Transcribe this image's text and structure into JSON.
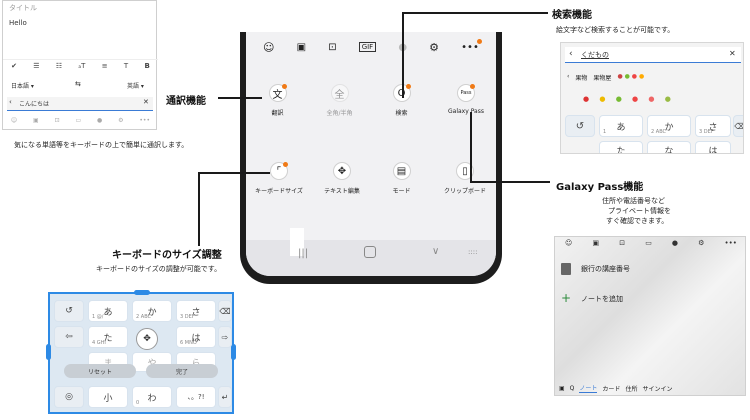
{
  "phone": {
    "toolbar_icons": [
      "smiley-icon",
      "sticker-icon",
      "emoji-icon",
      "gif-icon",
      "mic-icon",
      "gear-icon",
      "more-icon"
    ],
    "tools_row1": [
      {
        "label": "翻訳",
        "icon": "translate-icon",
        "dot": true
      },
      {
        "label": "全角/半角",
        "icon": "width-icon",
        "dot": false,
        "disabled": true
      },
      {
        "label": "検索",
        "icon": "search-icon",
        "dot": true
      },
      {
        "label": "Galaxy Pass",
        "icon": "pass-icon",
        "dot": true
      }
    ],
    "tools_row2": [
      {
        "label": "キーボードサイズ",
        "icon": "resize-icon",
        "dot": true
      },
      {
        "label": "テキスト編集",
        "icon": "cursor-icon",
        "dot": false
      },
      {
        "label": "モード",
        "icon": "mode-icon",
        "dot": false
      },
      {
        "label": "クリップボード",
        "icon": "clipboard-icon",
        "dot": false
      }
    ]
  },
  "callouts": {
    "translate": {
      "title": "通訳機能",
      "desc": "気になる単語等をキーボードの上で簡単に通訳します。"
    },
    "search": {
      "title": "検索機能",
      "desc": "絵文字など検索することが可能です。"
    },
    "pass": {
      "title": "Galaxy Pass機能",
      "desc1": "住所や電話番号など",
      "desc2": "プライベート情報を",
      "desc3": "すぐ確認できます。"
    },
    "size": {
      "title": "キーボードのサイズ調整",
      "desc": "キーボードのサイズの調整が可能です。"
    }
  },
  "translate_panel": {
    "title_placeholder": "タイトル",
    "body_text": "Hello",
    "lang_from": "日本語 ▾",
    "lang_to": "英語 ▾",
    "input_text": "こんにちは",
    "swap": "⇆"
  },
  "search_panel": {
    "query": "くだもの",
    "tabs": [
      "果物",
      "果物屋"
    ],
    "keys": [
      {
        "main": "あ",
        "sub": "1"
      },
      {
        "main": "か",
        "sub": "2 ABC"
      },
      {
        "main": "さ",
        "sub": "3 DEF"
      }
    ],
    "keys_row2": [
      "た",
      "な",
      "は"
    ]
  },
  "pass_panel": {
    "item1": "銀行の講座番号",
    "item2": "ノートを追加",
    "bottom_tabs": [
      "ノート",
      "カード",
      "住所",
      "サインイン"
    ]
  },
  "size_panel": {
    "reset": "リセット",
    "done": "完了",
    "keys": [
      {
        "main": "あ",
        "sub": "1 @/"
      },
      {
        "main": "か",
        "sub": "2 ABC"
      },
      {
        "main": "さ",
        "sub": "3 DEF"
      },
      {
        "main": "た",
        "sub": "4 GHI"
      },
      {
        "main": "",
        "sub": ""
      },
      {
        "main": "は",
        "sub": "6 MNO"
      },
      {
        "main": "ま",
        "sub": ""
      },
      {
        "main": "や",
        "sub": ""
      },
      {
        "main": "ら",
        "sub": ""
      },
      {
        "main": "小",
        "sub": ""
      },
      {
        "main": "わ",
        "sub": "0"
      },
      {
        "main": "、。?!",
        "sub": ""
      }
    ]
  }
}
